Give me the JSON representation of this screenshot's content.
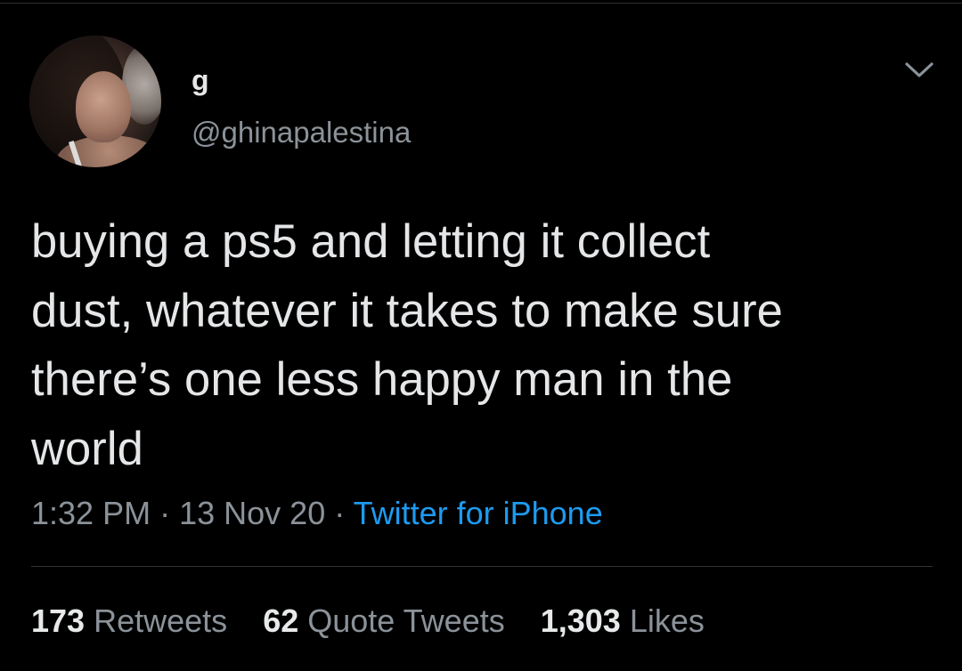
{
  "tweet": {
    "display_name": "g",
    "handle": "@ghinapalestina",
    "text_lines": [
      "buying a ps5 and letting it collect",
      "dust, whatever it takes to make sure",
      "there’s one less happy man in the",
      "world"
    ],
    "time": "1:32 PM",
    "date": "13 Nov 20",
    "source": "Twitter for iPhone",
    "separator": "·",
    "stats": {
      "retweets_count": "173",
      "retweets_label": "Retweets",
      "quote_tweets_count": "62",
      "quote_tweets_label": "Quote Tweets",
      "likes_count": "1,303",
      "likes_label": "Likes"
    },
    "menu_icon": "chevron-down-icon"
  },
  "colors": {
    "background": "#000000",
    "text_primary": "#e4e6e8",
    "text_secondary": "#8b9299",
    "link": "#1d9bf0",
    "divider": "#2f3336"
  }
}
